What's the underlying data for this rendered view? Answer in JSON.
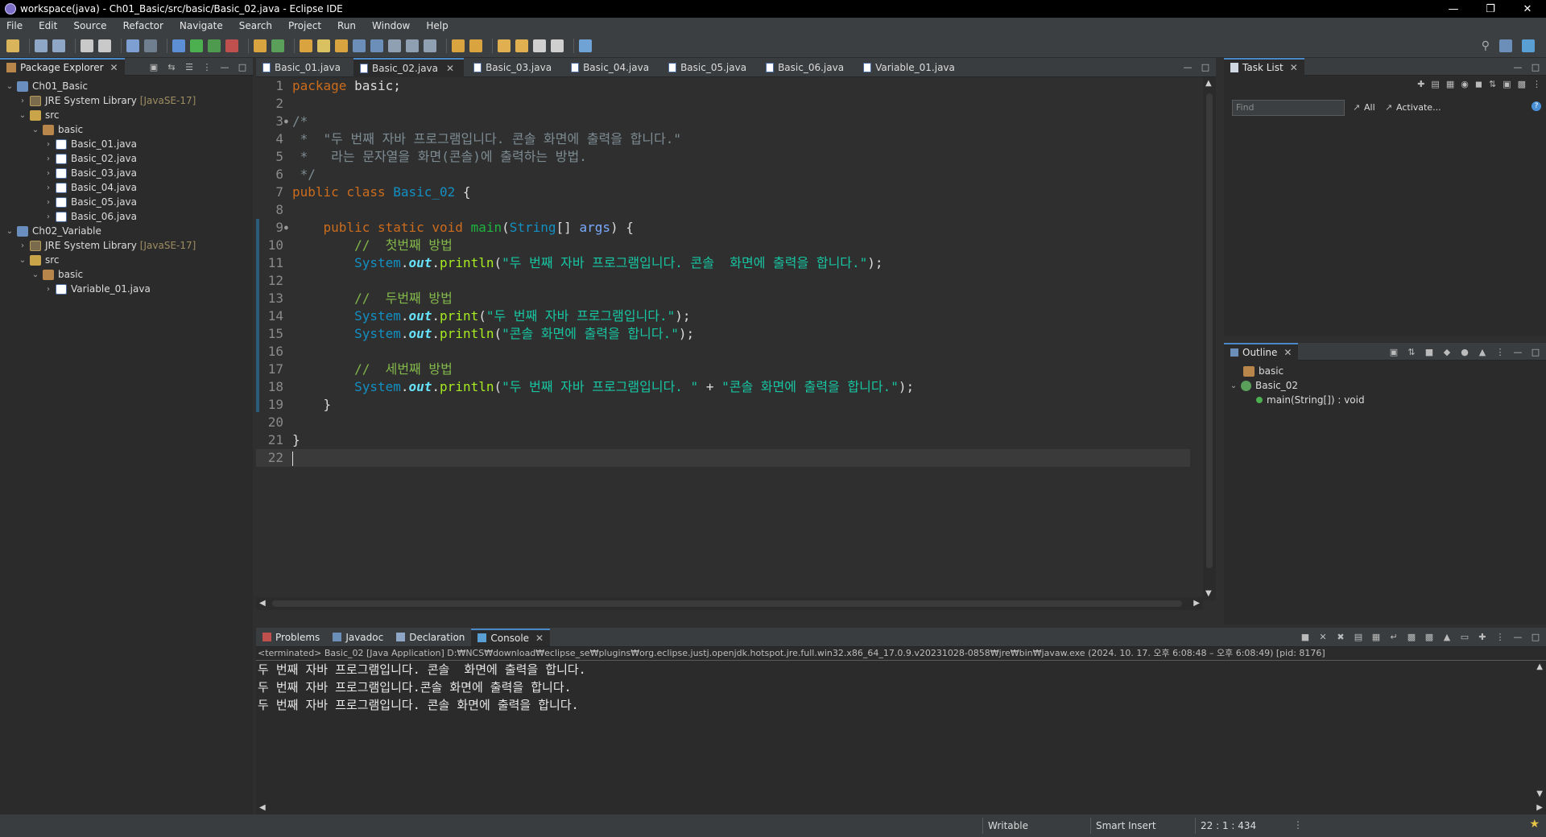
{
  "window": {
    "title": "workspace(java) - Ch01_Basic/src/basic/Basic_02.java - Eclipse IDE"
  },
  "menu": [
    "File",
    "Edit",
    "Source",
    "Refactor",
    "Navigate",
    "Search",
    "Project",
    "Run",
    "Window",
    "Help"
  ],
  "package_explorer": {
    "title": "Package Explorer",
    "tree": [
      {
        "label": "Ch01_Basic",
        "deco": "",
        "level": 0,
        "icon": "project"
      },
      {
        "label": "JRE System Library",
        "deco": "[JavaSE-17]",
        "level": 1,
        "icon": "lib"
      },
      {
        "label": "src",
        "deco": "",
        "level": 1,
        "icon": "src"
      },
      {
        "label": "basic",
        "deco": "",
        "level": 2,
        "icon": "pkg"
      },
      {
        "label": "Basic_01.java",
        "deco": "",
        "level": 3,
        "icon": "java"
      },
      {
        "label": "Basic_02.java",
        "deco": "",
        "level": 3,
        "icon": "java"
      },
      {
        "label": "Basic_03.java",
        "deco": "",
        "level": 3,
        "icon": "java"
      },
      {
        "label": "Basic_04.java",
        "deco": "",
        "level": 3,
        "icon": "java"
      },
      {
        "label": "Basic_05.java",
        "deco": "",
        "level": 3,
        "icon": "java"
      },
      {
        "label": "Basic_06.java",
        "deco": "",
        "level": 3,
        "icon": "java"
      },
      {
        "label": "Ch02_Variable",
        "deco": "",
        "level": 0,
        "icon": "project"
      },
      {
        "label": "JRE System Library",
        "deco": "[JavaSE-17]",
        "level": 1,
        "icon": "lib"
      },
      {
        "label": "src",
        "deco": "",
        "level": 1,
        "icon": "src"
      },
      {
        "label": "basic",
        "deco": "",
        "level": 2,
        "icon": "pkg"
      },
      {
        "label": "Variable_01.java",
        "deco": "",
        "level": 3,
        "icon": "java"
      }
    ]
  },
  "editor_tabs": [
    {
      "label": "Basic_01.java",
      "active": false
    },
    {
      "label": "Basic_02.java",
      "active": true
    },
    {
      "label": "Basic_03.java",
      "active": false
    },
    {
      "label": "Basic_04.java",
      "active": false
    },
    {
      "label": "Basic_05.java",
      "active": false
    },
    {
      "label": "Basic_06.java",
      "active": false
    },
    {
      "label": "Variable_01.java",
      "active": false
    }
  ],
  "code": [
    {
      "n": "1",
      "tokens": [
        [
          "kw",
          "package"
        ],
        [
          "",
          " basic;"
        ]
      ]
    },
    {
      "n": "2",
      "tokens": []
    },
    {
      "n": "3",
      "marker": true,
      "tokens": [
        [
          "cm",
          "/*"
        ]
      ]
    },
    {
      "n": "4",
      "tokens": [
        [
          "cm",
          " *  \"두 번째 자바 프로그램입니다. 콘솔 화면에 출력을 합니다.\""
        ]
      ]
    },
    {
      "n": "5",
      "tokens": [
        [
          "cm",
          " *   라는 문자열을 화면(콘솔)에 출력하는 방법."
        ]
      ]
    },
    {
      "n": "6",
      "tokens": [
        [
          "cm",
          " */"
        ]
      ]
    },
    {
      "n": "7",
      "tokens": [
        [
          "kw",
          "public class "
        ],
        [
          "cls",
          "Basic_02"
        ],
        [
          "",
          " {"
        ]
      ]
    },
    {
      "n": "8",
      "tokens": []
    },
    {
      "n": "9",
      "marker": true,
      "tokens": [
        [
          "",
          "    "
        ],
        [
          "kw",
          "public static void "
        ],
        [
          "fnm",
          "main"
        ],
        [
          "",
          "("
        ],
        [
          "cls",
          "String"
        ],
        [
          "",
          "[] "
        ],
        [
          "prm",
          "args"
        ],
        [
          "",
          ") {"
        ]
      ]
    },
    {
      "n": "10",
      "tokens": [
        [
          "",
          "        "
        ],
        [
          "cmk",
          "//  첫번째 방법"
        ]
      ]
    },
    {
      "n": "11",
      "tokens": [
        [
          "",
          "        "
        ],
        [
          "cls",
          "System"
        ],
        [
          "",
          "."
        ],
        [
          "fld",
          "out"
        ],
        [
          "",
          "."
        ],
        [
          "mth",
          "println"
        ],
        [
          "",
          "("
        ],
        [
          "str",
          "\"두 번째 자바 프로그램입니다. 콘솔  화면에 출력을 합니다.\""
        ],
        [
          "",
          ");"
        ]
      ]
    },
    {
      "n": "12",
      "tokens": []
    },
    {
      "n": "13",
      "tokens": [
        [
          "",
          "        "
        ],
        [
          "cmk",
          "//  두번째 방법"
        ]
      ]
    },
    {
      "n": "14",
      "tokens": [
        [
          "",
          "        "
        ],
        [
          "cls",
          "System"
        ],
        [
          "",
          "."
        ],
        [
          "fld",
          "out"
        ],
        [
          "",
          "."
        ],
        [
          "mth",
          "print"
        ],
        [
          "",
          "("
        ],
        [
          "str",
          "\"두 번째 자바 프로그램입니다.\""
        ],
        [
          "",
          ");"
        ]
      ]
    },
    {
      "n": "15",
      "tokens": [
        [
          "",
          "        "
        ],
        [
          "cls",
          "System"
        ],
        [
          "",
          "."
        ],
        [
          "fld",
          "out"
        ],
        [
          "",
          "."
        ],
        [
          "mth",
          "println"
        ],
        [
          "",
          "("
        ],
        [
          "str",
          "\"콘솔 화면에 출력을 합니다.\""
        ],
        [
          "",
          ");"
        ]
      ]
    },
    {
      "n": "16",
      "tokens": []
    },
    {
      "n": "17",
      "tokens": [
        [
          "",
          "        "
        ],
        [
          "cmk",
          "//  세번째 방법"
        ]
      ]
    },
    {
      "n": "18",
      "tokens": [
        [
          "",
          "        "
        ],
        [
          "cls",
          "System"
        ],
        [
          "",
          "."
        ],
        [
          "fld",
          "out"
        ],
        [
          "",
          "."
        ],
        [
          "mth",
          "println"
        ],
        [
          "",
          "("
        ],
        [
          "str",
          "\"두 번째 자바 프로그램입니다. \""
        ],
        [
          "",
          " + "
        ],
        [
          "str",
          "\"콘솔 화면에 출력을 합니다.\""
        ],
        [
          "",
          ");"
        ]
      ]
    },
    {
      "n": "19",
      "tokens": [
        [
          "",
          "    }"
        ]
      ]
    },
    {
      "n": "20",
      "tokens": []
    },
    {
      "n": "21",
      "tokens": [
        [
          "",
          "}"
        ]
      ]
    },
    {
      "n": "22",
      "current": true,
      "tokens": []
    }
  ],
  "task_list": {
    "title": "Task List",
    "find_placeholder": "Find",
    "all_label": "All",
    "activate_label": "Activate..."
  },
  "outline": {
    "title": "Outline",
    "items": [
      {
        "label": "basic",
        "level": 0,
        "icon": "pkg"
      },
      {
        "label": "Basic_02",
        "level": 0,
        "icon": "class"
      },
      {
        "label": "main(String[]) : void",
        "level": 1,
        "icon": "method"
      }
    ]
  },
  "bottom_tabs": [
    {
      "label": "Problems",
      "active": false
    },
    {
      "label": "Javadoc",
      "active": false
    },
    {
      "label": "Declaration",
      "active": false
    },
    {
      "label": "Console",
      "active": true
    }
  ],
  "console": {
    "info": "<terminated> Basic_02 [Java Application] D:₩NCS₩download₩eclipse_se₩plugins₩org.eclipse.justj.openjdk.hotspot.jre.full.win32.x86_64_17.0.9.v20231028-0858₩jre₩bin₩javaw.exe  (2024. 10. 17. 오후 6:08:48 – 오후 6:08:49) [pid: 8176]",
    "lines": [
      "두 번째 자바 프로그램입니다. 콘솔  화면에 출력을 합니다.",
      "두 번째 자바 프로그램입니다.콘솔 화면에 출력을 합니다.",
      "두 번째 자바 프로그램입니다. 콘솔 화면에 출력을 합니다."
    ]
  },
  "status": {
    "writable": "Writable",
    "insert_mode": "Smart Insert",
    "position": "22 : 1 : 434"
  }
}
